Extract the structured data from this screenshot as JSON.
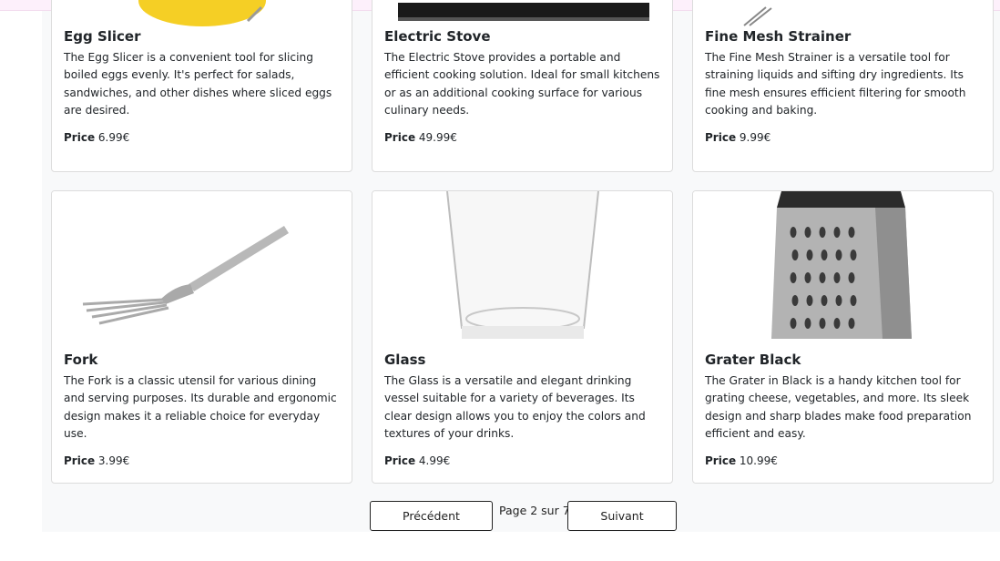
{
  "products_row1": [
    {
      "name": "Egg Slicer",
      "description": "The Egg Slicer is a convenient tool for slicing boiled eggs evenly. It's perfect for salads, sandwiches, and other dishes where sliced eggs are desired.",
      "price_label": "Price",
      "price": "6.99€"
    },
    {
      "name": "Electric Stove",
      "description": "The Electric Stove provides a portable and efficient cooking solution. Ideal for small kitchens or as an additional cooking surface for various culinary needs.",
      "price_label": "Price",
      "price": "49.99€"
    },
    {
      "name": "Fine Mesh Strainer",
      "description": "The Fine Mesh Strainer is a versatile tool for straining liquids and sifting dry ingredients. Its fine mesh ensures efficient filtering for smooth cooking and baking.",
      "price_label": "Price",
      "price": "9.99€"
    }
  ],
  "products_row2": [
    {
      "name": "Fork",
      "description": "The Fork is a classic utensil for various dining and serving purposes. Its durable and ergonomic design makes it a reliable choice for everyday use.",
      "price_label": "Price",
      "price": "3.99€"
    },
    {
      "name": "Glass",
      "description": "The Glass is a versatile and elegant drinking vessel suitable for a variety of beverages. Its clear design allows you to enjoy the colors and textures of your drinks.",
      "price_label": "Price",
      "price": "4.99€"
    },
    {
      "name": "Grater Black",
      "description": "The Grater in Black is a handy kitchen tool for grating cheese, vegetables, and more. Its sleek design and sharp blades make food preparation efficient and easy.",
      "price_label": "Price",
      "price": "10.99€"
    }
  ],
  "pagination": {
    "prev": "Précédent",
    "status": "Page 2 sur 7",
    "next": "Suivant"
  }
}
